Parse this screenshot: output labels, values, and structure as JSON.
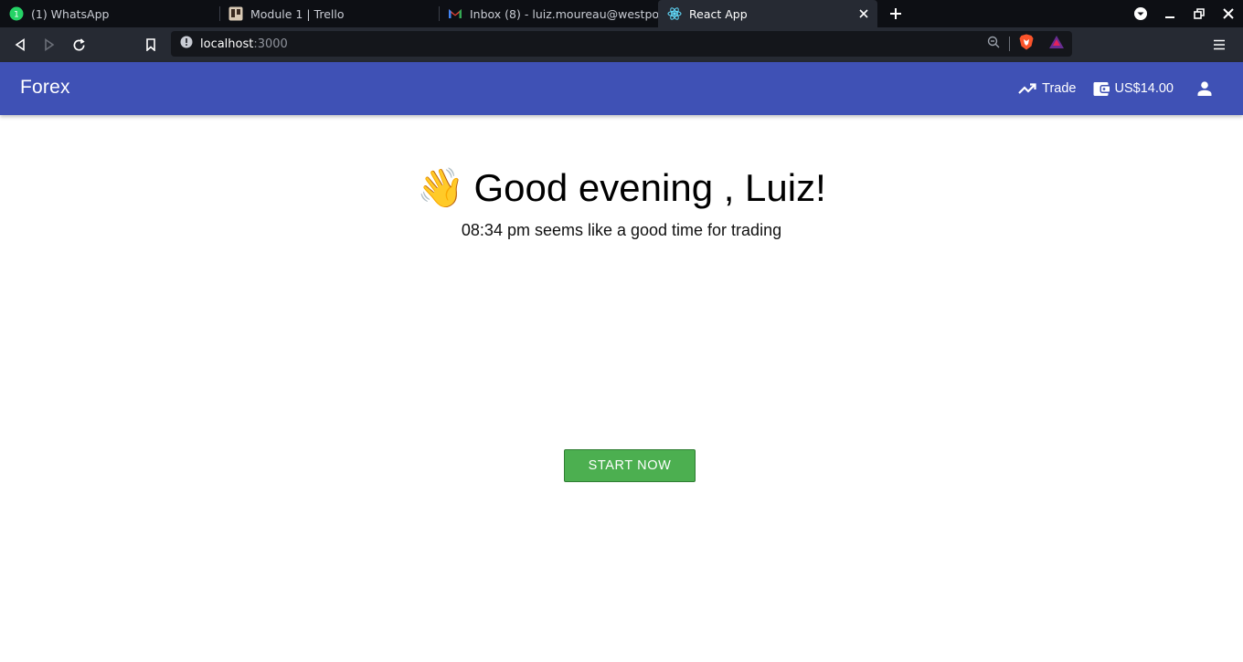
{
  "browser": {
    "tabs": [
      {
        "title": "(1) WhatsApp",
        "icon": "whatsapp-icon",
        "active": false
      },
      {
        "title": "Module 1 | Trello",
        "icon": "trello-icon",
        "active": false
      },
      {
        "title": "Inbox (8) - luiz.moureau@westpoi",
        "icon": "gmail-icon",
        "active": false
      },
      {
        "title": "React App",
        "icon": "react-icon",
        "active": true
      }
    ],
    "url_host": "localhost",
    "url_port": ":3000"
  },
  "app": {
    "brand": "Forex",
    "trade_label": "Trade",
    "wallet_balance": "US$14.00",
    "accent_color": "#3f51b5"
  },
  "main": {
    "wave_emoji": "👋",
    "greeting": "Good evening , Luiz!",
    "subtitle": "08:34 pm seems like a good time for trading",
    "start_button": "START NOW",
    "start_button_color": "#4caf50"
  }
}
